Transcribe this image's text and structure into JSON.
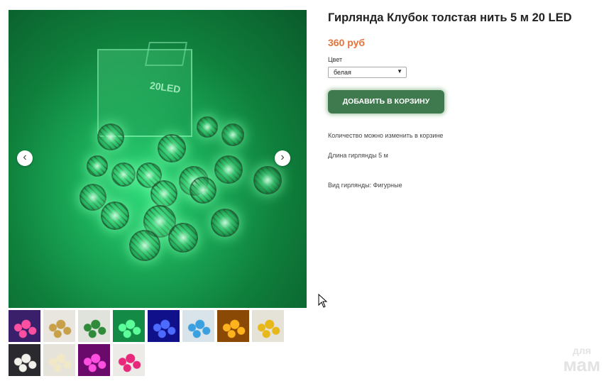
{
  "product": {
    "title": "Гирлянда Клубок толстая нить 5 м 20 LED",
    "price": "360 руб",
    "color_label": "Цвет",
    "color_selected": "белая",
    "add_to_cart": "ДОБАВИТЬ В КОРЗИНУ",
    "note_quantity": "Количество можно изменить в корзине",
    "length": "Длина гирлянды 5 м",
    "type": "Вид гирлянды: Фигурные"
  },
  "gallery": {
    "box_label": "20LED",
    "prev_icon": "chevron-left-icon",
    "next_icon": "chevron-right-icon",
    "thumbnails": [
      {
        "name": "thumb-multicolor",
        "bg": "#3a1f6a",
        "accent": "#ff4fa0"
      },
      {
        "name": "thumb-warm-mix",
        "bg": "#e9e6e0",
        "accent": "#c8a04a"
      },
      {
        "name": "thumb-green-white",
        "bg": "#dfe3dc",
        "accent": "#2f8a3a"
      },
      {
        "name": "thumb-green",
        "bg": "#138a45",
        "accent": "#5dff9a"
      },
      {
        "name": "thumb-blue",
        "bg": "#10108a",
        "accent": "#4d6bff"
      },
      {
        "name": "thumb-light-blue",
        "bg": "#d8e3ea",
        "accent": "#3aa0e0"
      },
      {
        "name": "thumb-warm",
        "bg": "#8a4a06",
        "accent": "#ffb31c"
      },
      {
        "name": "thumb-yellow",
        "bg": "#e5e2d8",
        "accent": "#e6b81a"
      },
      {
        "name": "thumb-white",
        "bg": "#2a2a2e",
        "accent": "#f2f0ea"
      },
      {
        "name": "thumb-cream",
        "bg": "#e6e3da",
        "accent": "#f1e8c8"
      },
      {
        "name": "thumb-pink",
        "bg": "#6a0a6a",
        "accent": "#ff4fe0"
      },
      {
        "name": "thumb-fuchsia",
        "bg": "#ecebe8",
        "accent": "#e8287a"
      }
    ]
  },
  "watermark": {
    "top": "для",
    "bottom": "мам"
  }
}
